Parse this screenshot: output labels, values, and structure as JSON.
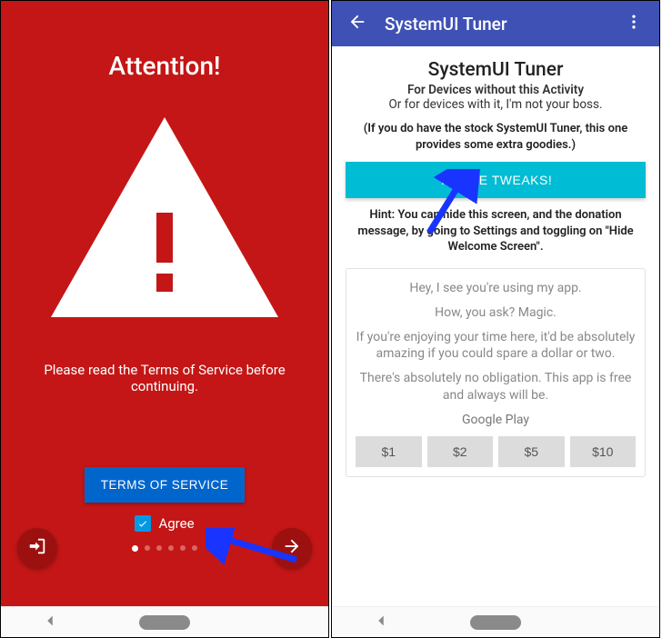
{
  "left": {
    "title": "Attention!",
    "message": "Please read the Terms of Service before continuing.",
    "tosButton": "TERMS OF SERVICE",
    "agreeLabel": "Agree"
  },
  "right": {
    "appbarTitle": "SystemUI Tuner",
    "heading": "SystemUI Tuner",
    "sub1": "For Devices without this Activity",
    "sub2": "Or for devices with it, I'm not your boss.",
    "disclaimer": "(If you do have the stock SystemUI Tuner, this one provides some extra goodies.)",
    "tweaksButton": "TO THE TWEAKS!",
    "hint": "Hint: You can hide this screen, and the donation message, by going to Settings and toggling on \"Hide Welcome Screen\".",
    "card": {
      "l1": "Hey, I see you're using my app.",
      "l2": "How, you ask? Magic.",
      "l3": "If you're enjoying your time here, it'd be absolutely amazing if you could spare a dollar or two.",
      "l4": "There's absolutely no obligation. This app is free and always will be.",
      "store": "Google Play",
      "donate": {
        "d1": "$1",
        "d2": "$2",
        "d5": "$5",
        "d10": "$10"
      }
    }
  }
}
